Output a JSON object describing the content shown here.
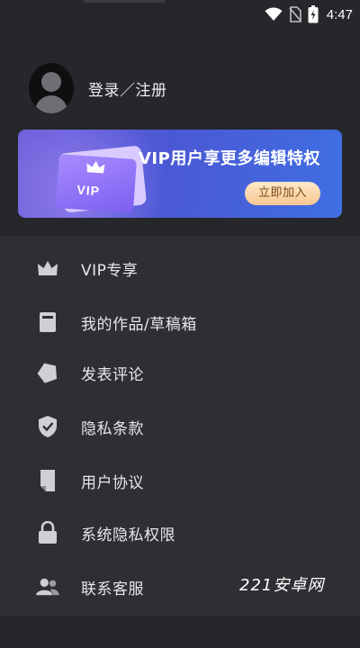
{
  "status_bar": {
    "time": "4:47"
  },
  "profile": {
    "login_label": "登录／注册"
  },
  "vip_banner": {
    "title": "VIP用户享更多编辑特权",
    "card_label": "VIP",
    "button_label": "立即加入"
  },
  "menu": [
    {
      "label": "VIP专享",
      "icon": "crown-icon"
    },
    {
      "label": "我的作品/草稿箱",
      "icon": "drafts-box-icon"
    },
    {
      "label": "发表评论",
      "icon": "star-badge-icon"
    },
    {
      "label": "隐私条款",
      "icon": "shield-check-icon"
    },
    {
      "label": "用户协议",
      "icon": "document-icon"
    },
    {
      "label": "系统隐私权限",
      "icon": "lock-icon"
    },
    {
      "label": "联系客服",
      "icon": "people-icon"
    }
  ],
  "watermark": "221安卓网",
  "colors": {
    "background": "#2e2f33",
    "header_background": "#26272b",
    "icon": "#cfd0d4",
    "banner_gradient_start": "#6c5fd8",
    "banner_gradient_end": "#3f6fe3",
    "join_button": "#f7c792"
  }
}
